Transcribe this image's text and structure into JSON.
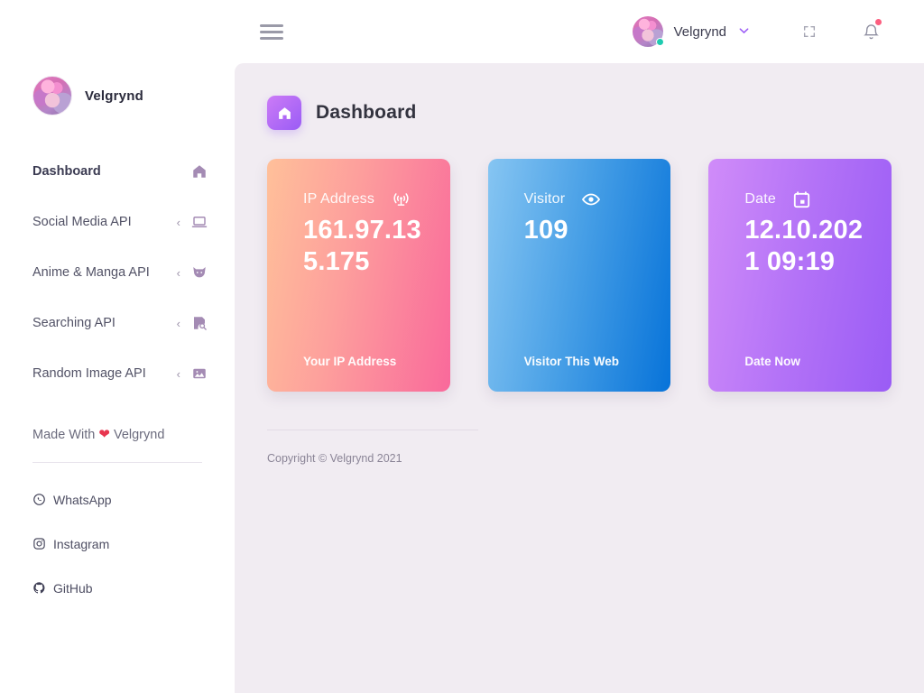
{
  "sidebar": {
    "profile": {
      "name": "Velgrynd",
      "avatar_icon": "user-avatar"
    },
    "items": [
      {
        "label": "Dashboard",
        "icon": "home-icon",
        "active": true,
        "has_chevron": false
      },
      {
        "label": "Social Media API",
        "icon": "laptop-icon",
        "active": false,
        "has_chevron": true
      },
      {
        "label": "Anime & Manga API",
        "icon": "cat-face-icon",
        "active": false,
        "has_chevron": true
      },
      {
        "label": "Searching API",
        "icon": "save-search-icon",
        "active": false,
        "has_chevron": true
      },
      {
        "label": "Random Image API",
        "icon": "image-icon",
        "active": false,
        "has_chevron": true
      }
    ],
    "chevron_glyph": "‹",
    "made_with": {
      "prefix": "Made With",
      "heart": "❤",
      "suffix": "Velgrynd"
    },
    "social": [
      {
        "label": "WhatsApp",
        "icon": "whatsapp-icon"
      },
      {
        "label": "Instagram",
        "icon": "instagram-icon"
      },
      {
        "label": "GitHub",
        "icon": "github-icon"
      }
    ]
  },
  "topbar": {
    "menu_icon": "hamburger-menu-icon",
    "user_name": "Velgrynd",
    "caret_glyph": "⌵",
    "status": "online",
    "fullscreen_icon": "fullscreen-icon",
    "bell_icon": "notification-bell-icon",
    "has_notification": true
  },
  "page": {
    "title": "Dashboard",
    "title_icon": "home-icon"
  },
  "cards": [
    {
      "title": "IP Address",
      "value": "161.97.135.175",
      "footer": "Your IP Address",
      "icon": "broadcast-icon",
      "color_from": "#ffc09a",
      "color_to": "#f9699b"
    },
    {
      "title": "Visitor",
      "value": "109",
      "footer": "Visitor This Web",
      "icon": "eye-icon",
      "color_from": "#86c5f2",
      "color_to": "#0773d9"
    },
    {
      "title": "Date",
      "value": "12.10.2021 09:19",
      "footer": "Date Now",
      "icon": "calendar-icon",
      "color_from": "#d08cf9",
      "color_to": "#9a5cf5"
    }
  ],
  "footer": {
    "copyright": "Copyright © Velgrynd 2021"
  },
  "theme": {
    "accent": "#9a5cf5",
    "content_bg": "#f1ecf2",
    "sidebar_bg": "#ffffff",
    "notification_dot": "#fc5e7f",
    "status_dot": "#1ecbb0",
    "heart": "#e8364f"
  }
}
